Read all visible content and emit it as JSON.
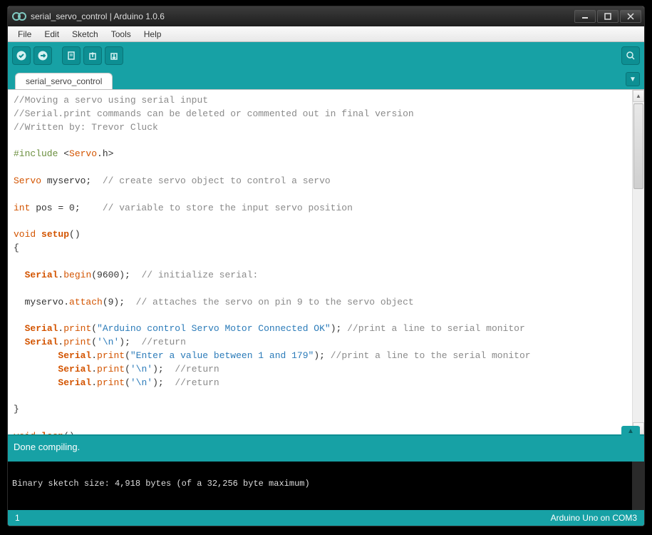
{
  "titlebar": {
    "title": "serial_servo_control | Arduino 1.0.6"
  },
  "menu": {
    "file": "File",
    "edit": "Edit",
    "sketch": "Sketch",
    "tools": "Tools",
    "help": "Help"
  },
  "tab": {
    "name": "serial_servo_control"
  },
  "status": {
    "compile": "Done compiling."
  },
  "console": {
    "line1": "Binary sketch size: 4,918 bytes (of a 32,256 byte maximum)"
  },
  "bottom": {
    "line": "1",
    "board": "Arduino Uno on COM3"
  },
  "icons": {
    "verify": "verify-icon",
    "upload": "upload-icon",
    "new": "new-icon",
    "open": "open-icon",
    "save": "save-icon",
    "serial": "serial-monitor-icon"
  },
  "code": {
    "l1a": "//Moving a servo using serial input",
    "l2a": "//Serial.print commands can be deleted or commented out in final version",
    "l3a": "//Written by: Trevor Cluck",
    "l5_inc": "#include",
    "l5_lt": " <",
    "l5_servo": "Servo",
    "l5_rest": ".h>",
    "l7_servo": "Servo",
    "l7_my": " myservo;  ",
    "l7_c": "// create servo object to control a servo",
    "l9_int": "int",
    "l9_pos": " pos = 0;    ",
    "l9_c": "// variable to store the input servo position",
    "l11_void": "void",
    "l11_setup": " setup",
    "l11_paren": "()",
    "l12_brace": "{",
    "l14_ind": "  ",
    "l14_serial": "Serial",
    "l14_dot": ".",
    "l14_begin": "begin",
    "l14_arg": "(9600);  ",
    "l14_c": "// initialize serial:",
    "l16_ind": "  myservo.",
    "l16_attach": "attach",
    "l16_arg": "(9);  ",
    "l16_c": "// attaches the servo on pin 9 to the servo object",
    "l18_ind": "  ",
    "l18_serial": "Serial",
    "l18_dot": ".",
    "l18_print": "print",
    "l18_p1": "(",
    "l18_str": "\"Arduino control Servo Motor Connected OK\"",
    "l18_p2": "); ",
    "l18_c": "//print a line to serial monitor",
    "l19_ind": "  ",
    "l19_serial": "Serial",
    "l19_dot": ".",
    "l19_print": "print",
    "l19_p1": "(",
    "l19_ch": "'\\n'",
    "l19_p2": ");  ",
    "l19_c": "//return",
    "l20_ind": "        ",
    "l20_serial": "Serial",
    "l20_dot": ".",
    "l20_print": "print",
    "l20_p1": "(",
    "l20_str": "\"Enter a value between 1 and 179\"",
    "l20_p2": "); ",
    "l20_c": "//print a line to the serial monitor",
    "l21_ind": "        ",
    "l21_serial": "Serial",
    "l21_dot": ".",
    "l21_print": "print",
    "l21_p1": "(",
    "l21_ch": "'\\n'",
    "l21_p2": ");  ",
    "l21_c": "//return",
    "l22_ind": "        ",
    "l22_serial": "Serial",
    "l22_dot": ".",
    "l22_print": "print",
    "l22_p1": "(",
    "l22_ch": "'\\n'",
    "l22_p2": ");  ",
    "l22_c": "//return",
    "l24_brace": "}",
    "l26_void": "void",
    "l26_loop": " loop",
    "l26_paren": "()",
    "l27_brace": "{"
  }
}
